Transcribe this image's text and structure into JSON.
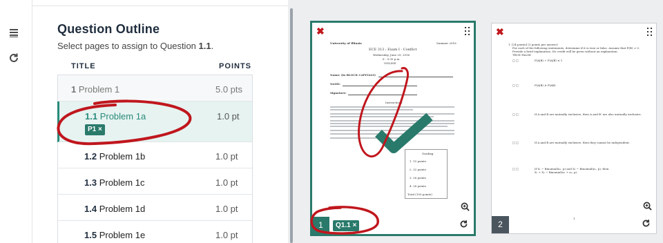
{
  "rail": {
    "icons": [
      "list-icon",
      "refresh-icon"
    ]
  },
  "outline": {
    "title": "Question Outline",
    "subtitle_prefix": "Select pages to assign to Question ",
    "subtitle_question": "1.1",
    "subtitle_suffix": ".",
    "col_title": "TITLE",
    "col_points": "POINTS",
    "rows": [
      {
        "num": "1",
        "name": "Problem 1",
        "points": "5.0 pts"
      },
      {
        "num": "1.1",
        "name": "Problem 1a",
        "points": "1.0 pt",
        "tag": "P1 ×"
      },
      {
        "num": "1.2",
        "name": "Problem 1b",
        "points": "1.0 pt"
      },
      {
        "num": "1.3",
        "name": "Problem 1c",
        "points": "1.0 pt"
      },
      {
        "num": "1.4",
        "name": "Problem 1d",
        "points": "1.0 pt"
      },
      {
        "num": "1.5",
        "name": "Problem 1e",
        "points": "1.0 pt"
      }
    ]
  },
  "pages": [
    {
      "number": "1",
      "tag": "Q1.1 ×",
      "doc": {
        "univ": "University of Illinois",
        "term": "Summer 2016",
        "exam": "ECE 313 : Exam I - Conflict",
        "date": "Wednesday, June 29, 2016",
        "time": "8 - 9:30 p.m.",
        "mode": "ONLINE",
        "name_label": "Name: (in BLOCK CAPITALS)",
        "netid_label": "NetID:",
        "sig_label": "Signature:",
        "instructions": "Instructions",
        "grading": "Grading",
        "g1": "1. 15 points",
        "g2": "2. 32 points",
        "g3": "3. 26 points",
        "g4": "4. 28 points",
        "total": "Total (100 points)"
      }
    },
    {
      "number": "2",
      "doc": {
        "q1": "1. [24 points] (3 points per answer)",
        "q1b": "For each of the following statements, determine if it is true or false. Assume that P(B) > 0.",
        "q1c": "Provide a brief explanation. No credit will be given without an explanation.",
        "q1d": "TRUE   FALSE",
        "s1": "P(A|B) + P(A|B̄) ≤ 1",
        "s2": "P(A|B) ≥ P(AB)",
        "s3": "If A and B are mutually exclusive, then A and Bᶜ are also mutually exclusive.",
        "s4": "If A and B are mutually exclusive, then they cannot be independent.",
        "s5": "If X₁ ∼ Binomial(n₁, p) and X₂ ∼ Binomial(n₂, p), then",
        "s5b": "X₁ + X₂ ∼ Binomial(n₁ + n₂, p)",
        "footer": "1"
      }
    }
  ],
  "colors": {
    "accent": "#2a7a6b",
    "annotation": "#c0161d"
  }
}
